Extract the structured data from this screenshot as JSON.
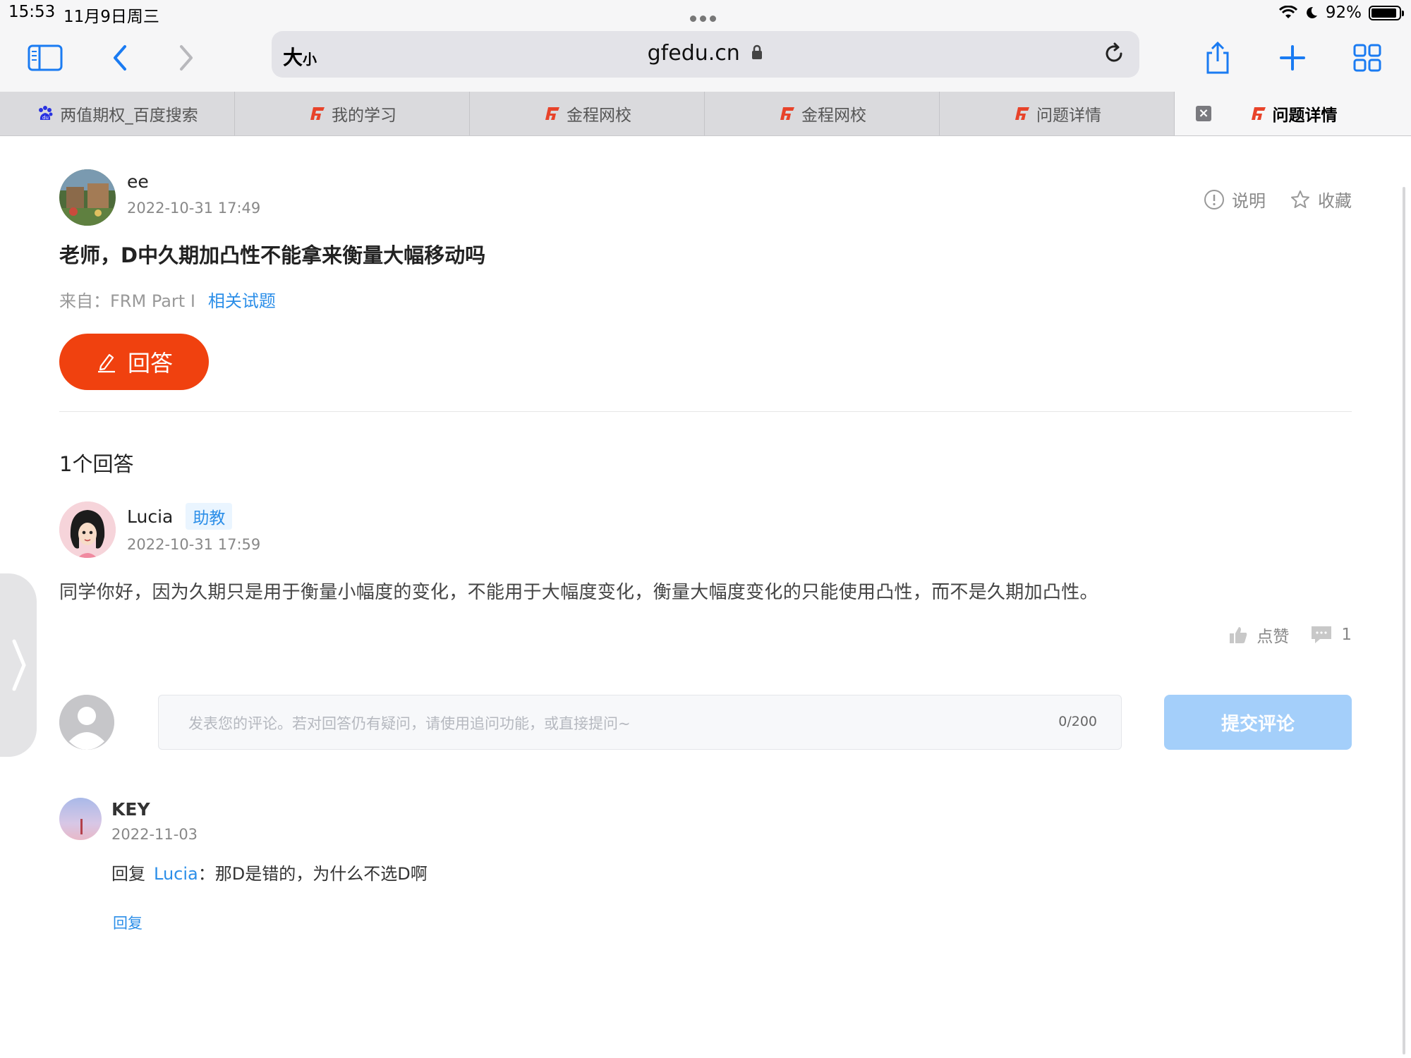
{
  "status_bar": {
    "time": "15:53",
    "date": "11月9日周三",
    "battery": "92%",
    "battery_level": 0.92
  },
  "toolbar": {
    "size_label": "大",
    "size_label_small": "小",
    "url": "gfedu.cn"
  },
  "tabs": [
    {
      "label": "两值期权_百度搜索",
      "icon": "baidu-icon"
    },
    {
      "label": "我的学习",
      "icon": "gfedu-logo-icon"
    },
    {
      "label": "金程网校",
      "icon": "gfedu-logo-icon"
    },
    {
      "label": "金程网校",
      "icon": "gfedu-logo-icon"
    },
    {
      "label": "问题详情",
      "icon": "gfedu-logo-icon"
    },
    {
      "label": "问题详情",
      "icon": "gfedu-logo-icon",
      "active": true
    }
  ],
  "question": {
    "user": "ee",
    "time": "2022-10-31 17:49",
    "title": "老师，D中久期加凸性不能拿来衡量大幅移动吗",
    "from": "来自：FRM Part I",
    "related": "相关试题",
    "explain": "说明",
    "favorite": "收藏",
    "answer_button": "回答"
  },
  "answers": {
    "count_label": "1个回答",
    "items": [
      {
        "user": "Lucia",
        "badge": "助教",
        "time": "2022-10-31 17:59",
        "text": "同学你好，因为久期只是用于衡量小幅度的变化，不能用于大幅度变化，衡量大幅度变化的只能使用凸性，而不是久期加凸性。",
        "like_label": "点赞",
        "comment_count": "1"
      }
    ]
  },
  "comment_form": {
    "placeholder": "发表您的评论。若对回答仍有疑问，请使用追问功能，或直接提问~",
    "counter": "0/200",
    "submit": "提交评论"
  },
  "comments": [
    {
      "user": "KEY",
      "time": "2022-11-03",
      "reply_prefix": "回复",
      "mention": "Lucia",
      "text": "：那D是错的，为什么不选D啊",
      "reply_link": "回复"
    }
  ],
  "colors": {
    "accent_orange": "#f0410f",
    "link_blue": "#2b8ee8",
    "submit_disabled": "#a4cffa"
  }
}
